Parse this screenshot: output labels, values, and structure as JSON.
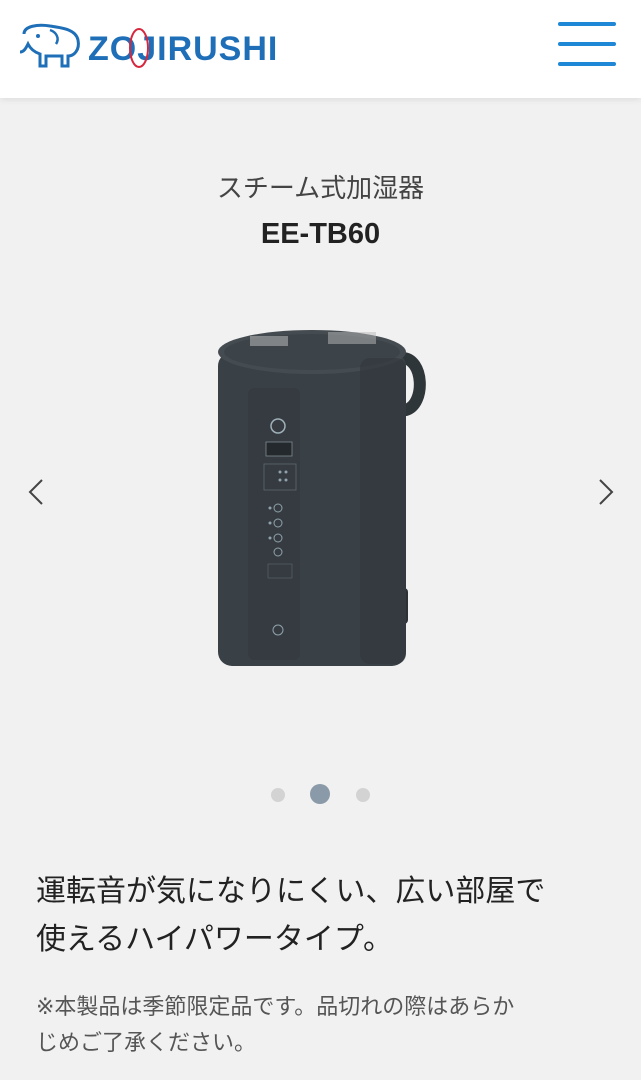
{
  "header": {
    "brand": "ZOJIRUSHI",
    "logo_icon": "elephant-logo-icon",
    "menu_icon": "hamburger-menu-icon",
    "brand_color": "#1e6fb8",
    "menu_color": "#1e87d6"
  },
  "product": {
    "category": "スチーム式加湿器",
    "model": "EE-TB60",
    "image_icon": "steam-humidifier-image",
    "body_color": "#3a4146"
  },
  "carousel": {
    "prev_icon": "chevron-left-icon",
    "next_icon": "chevron-right-icon",
    "slide_count": 3,
    "active_index": 1
  },
  "description": {
    "tagline_line1": "運転音が気になりにくい、広い部屋で",
    "tagline_line2": "使えるハイパワータイプ。",
    "note_line1": "※本製品は季節限定品です。品切れの際はあらか",
    "note_line2": "じめご了承ください。"
  }
}
